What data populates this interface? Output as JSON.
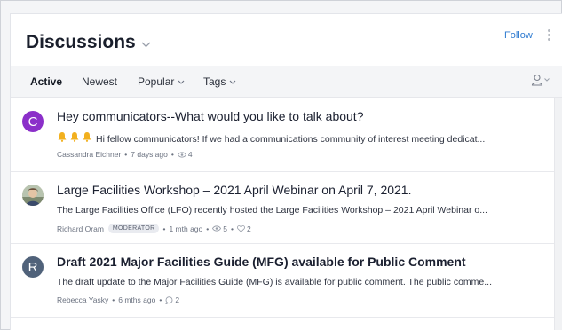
{
  "header": {
    "title": "Discussions",
    "follow_label": "Follow"
  },
  "tabs": [
    {
      "label": "Active"
    },
    {
      "label": "Newest"
    },
    {
      "label": "Popular"
    },
    {
      "label": "Tags"
    }
  ],
  "colors": {
    "accent": "#2f7bd0",
    "avatar_c": "#8b2fc9",
    "avatar_r": "#50627a"
  },
  "discussions": [
    {
      "avatar_letter": "C",
      "title": "Hey communicators--What would you like to talk about?",
      "snippet_icons": "bell-icon x3",
      "snippet": "Hi fellow communicators! If we had a communications community of interest meeting dedicat...",
      "author": "Cassandra Eichner",
      "time": "7 days ago",
      "views": "4"
    },
    {
      "avatar_image": "photo-avatar",
      "title": "Large Facilities Workshop – 2021 April Webinar on April 7, 2021.",
      "snippet": "The Large Facilities Office (LFO) recently hosted the Large Facilities Workshop – 2021 April Webinar o...",
      "author": "Richard Oram",
      "badge": "MODERATOR",
      "time": "1 mth ago",
      "views": "5",
      "likes": "2"
    },
    {
      "avatar_letter": "R",
      "title": "Draft 2021 Major Facilities Guide (MFG) available for Public Comment",
      "snippet": "The draft update to the Major Facilities Guide (MFG) is available for public comment. The public comme...",
      "author": "Rebecca Yasky",
      "time": "6 mths ago",
      "comments": "2"
    }
  ]
}
